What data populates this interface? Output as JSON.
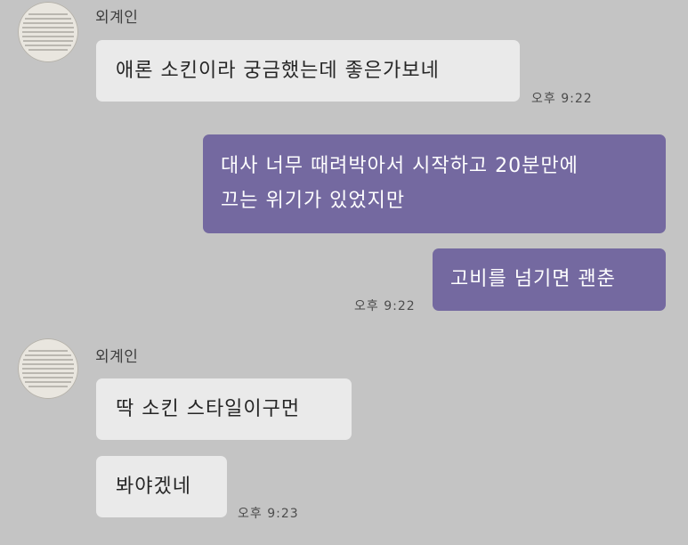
{
  "conversation": {
    "group1": {
      "sender": "외계인",
      "messages": [
        "애론 소킨이라 궁금했는데 좋은가보네"
      ],
      "time": "오후 9:22"
    },
    "group2": {
      "messages": [
        {
          "line1": "대사 너무 때려박아서 시작하고 20분만에",
          "line2": "끄는 위기가 있었지만"
        },
        "고비를 넘기면 괜춘"
      ],
      "time": "오후 9:22"
    },
    "group3": {
      "sender": "외계인",
      "messages": [
        "딱 소킨 스타일이구먼",
        "봐야겠네"
      ],
      "time": "오후 9:23"
    }
  },
  "colors": {
    "background": "#c4c4c4",
    "incoming_bubble": "#eaeaea",
    "outgoing_bubble": "#7469a0"
  },
  "icons": {
    "avatar": "avatar-icon"
  }
}
